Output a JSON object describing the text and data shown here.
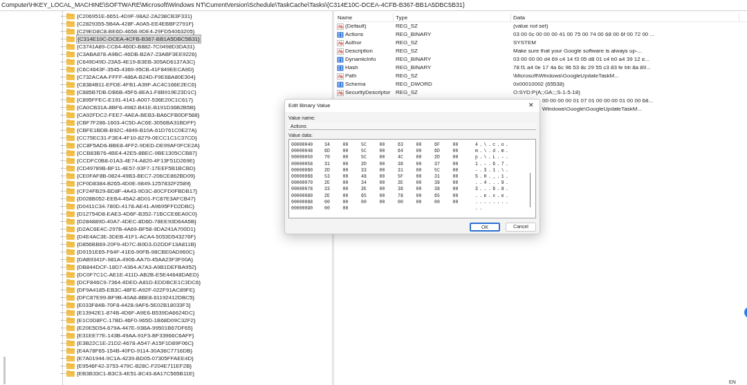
{
  "address_bar": "Computer\\HKEY_LOCAL_MACHINE\\SOFTWARE\\Microsoft\\Windows NT\\CurrentVersion\\Schedule\\TaskCache\\Tasks\\{C314E10C-DCEA-4CFB-B367-BB1A5DBC5B31}",
  "tree": {
    "items": [
      {
        "label": "{C206951E-6651-4D9F-98A2-2A238CB3F331}",
        "selected": false
      },
      {
        "label": "{C2829355-5B4A-428F-A0A5-EE4EBBF2791F}",
        "selected": false
      },
      {
        "label": "{C29ED8C8-BE6D-4658-9DE4-29FD54063205}",
        "selected": false
      },
      {
        "label": "{C314E10C-DCEA-4CFB-B367-BB1A5DBC5B31}",
        "selected": true
      },
      {
        "label": "{C3741A89-CC64-460D-B882-7C0498D3DA31}",
        "selected": false
      },
      {
        "label": "{C3ABA878-A9BC-46DB-B2A7-23ABF3EE9226}",
        "selected": false
      },
      {
        "label": "{C649D49D-23A5-4E19-B3EB-305AD6137A3C}",
        "selected": false
      },
      {
        "label": "{C6C4643F-3545-4369-95CB-41F849EECA9D}",
        "selected": false
      },
      {
        "label": "{C732ACAA-FFFF-486A-B24D-F9E68A80E304}",
        "selected": false
      },
      {
        "label": "{C8384B11-EFDE-4FB1-A39F-AC4C166E2EC6}",
        "selected": false
      },
      {
        "label": "{C885B7DB-DB6B-45F6-8EA1-F8B919E23D1C}",
        "selected": false
      },
      {
        "label": "{C895FFEC-E191-4141-A007-536E20C1C617}",
        "selected": false
      },
      {
        "label": "{CA0CB31A-8BF6-4982-B41E-B191D36B2B5B}",
        "selected": false
      },
      {
        "label": "{CA92FDC2-FEE7-4AEA-BEB3-BA6CFB0DF588}",
        "selected": false
      },
      {
        "label": "{CBF7F286-1603-4C5D-AC6E-3056BA31BDFF}",
        "selected": false
      },
      {
        "label": "{CBFE1BDB-B92C-4849-B10A-61D761C0E27A}",
        "selected": false
      },
      {
        "label": "{CC75EC31-F3E4-4F10-8279-0ECC1C1C37CD}",
        "selected": false
      },
      {
        "label": "{CC8F5AD6-BBE8-4FF2-9DED-DE99AF0FCE2A}",
        "selected": false
      },
      {
        "label": "{CCB83B76-4BE4-42E5-8BEC-9BE1305CCB87}",
        "selected": false
      },
      {
        "label": "{CCDFC0B8-01A3-4E74-A820-4F13F51D269E}",
        "selected": false
      },
      {
        "label": "{CD49789B-BF11-4E57-93F7-17EEF5B1BCBD}",
        "selected": false
      },
      {
        "label": "{CE0FAF8B-0824-49B3-BEC7-206CE862BD09}",
        "selected": false
      },
      {
        "label": "{CF0D8384-B265-4D0E-9849-1257832F2589}",
        "selected": false
      },
      {
        "label": "{CF24FB29-BD8F-4A43-9D3C-80CFD0FBDB17}",
        "selected": false
      },
      {
        "label": "{D028B052-EEB4-45A2-8D01-FC87E3AFCB47}",
        "selected": false
      },
      {
        "label": "{D0411C34-780D-4178-AE41-A9695FFD2DBC}",
        "selected": false
      },
      {
        "label": "{D12754D8-EAE3-4D6F-B352-71BCCE6EA0C0}",
        "selected": false
      },
      {
        "label": "{D284889D-40A7-4DEC-8D6D-78EE93D64A5B}",
        "selected": false
      },
      {
        "label": "{D2AC6E4C-297B-4A69-BF58-9DA241A700D1}",
        "selected": false
      },
      {
        "label": "{D4E4AC3E-3DEB-41F1-ACA4-5053D543276F}",
        "selected": false
      },
      {
        "label": "{D856BB69-20F9-4D7C-B0D3-D2DDF13A811B}",
        "selected": false
      },
      {
        "label": "{D9151E65-F64F-41E6-90FB-98CBE0AD960C}",
        "selected": false
      },
      {
        "label": "{DAB9341F-981A-4906-AA70-45AA23F3F00A}",
        "selected": false
      },
      {
        "label": "{DB844DCF-18D7-4364-A7A3-A9B1DEFBA952}",
        "selected": false
      },
      {
        "label": "{DC0F7C1C-AE1E-411D-AB2B-E5E44648DAED}",
        "selected": false
      },
      {
        "label": "{DCF846C9-7364-4DED-A81D-EDDBCE1C3DC6}",
        "selected": false
      },
      {
        "label": "{DF9A4185-EB3C-48FE-A92F-022F91AC89FE}",
        "selected": false
      },
      {
        "label": "{DFC87E99-BF9B-40A8-8BE8-61192412DBC5}",
        "selected": false
      },
      {
        "label": "{E033F84B-70F8-4428-9AF6-5E02B18033F3}",
        "selected": false
      },
      {
        "label": "{E13942E1-874B-4D6F-A9E6-B539DA6624DC}",
        "selected": false
      },
      {
        "label": "{E1C0D8FC-17BD-46F0-965D-1B68D09C32F2}",
        "selected": false
      },
      {
        "label": "{E20E5D54-679A-447E-93BA-99501B67DF65}",
        "selected": false
      },
      {
        "label": "{E31EE77E-143B-49AA-91F3-BF33966C6AFF}",
        "selected": false
      },
      {
        "label": "{E3B22C1E-21D2-4678-A547-A15F1D89F06C}",
        "selected": false
      },
      {
        "label": "{E4A78F65-154B-40FD-9114-30A36C7716DB}",
        "selected": false
      },
      {
        "label": "{E7A01944-9C1A-4239-BD05-07305FFAEE4D}",
        "selected": false
      },
      {
        "label": "{E9546F42-3753-479C-B28C-F204E711EF2B}",
        "selected": false
      },
      {
        "label": "{EB3B33C1-B3C3-4E51-8C43-8A17C565B11E}",
        "selected": false
      }
    ]
  },
  "values": {
    "columns": [
      "Name",
      "Type",
      "Data"
    ],
    "rows": [
      {
        "kind": "string",
        "name": "(Default)",
        "type": "REG_SZ",
        "data": "(value not set)"
      },
      {
        "kind": "binary",
        "name": "Actions",
        "type": "REG_BINARY",
        "data": "03 00 0c 00 00 00 41 00 75 00 74 00 68 00 6f 00 72 00 ..."
      },
      {
        "kind": "string",
        "name": "Author",
        "type": "REG_SZ",
        "data": "SYSTEM"
      },
      {
        "kind": "string",
        "name": "Description",
        "type": "REG_SZ",
        "data": "Make sure that your Google software is always up-..."
      },
      {
        "kind": "binary",
        "name": "DynamicInfo",
        "type": "REG_BINARY",
        "data": "03 00 00 00 d4 69 c4 14 f3 05 d8 01 c4 b0 a4 39 12 e..."
      },
      {
        "kind": "binary",
        "name": "Hash",
        "type": "REG_BINARY",
        "data": "78 f1 a4 0e 17 4a 6c 96 53 8c 29 55 c3 83 fe bb 8a 89..."
      },
      {
        "kind": "string",
        "name": "Path",
        "type": "REG_SZ",
        "data": "\\Microsoft\\Windows\\GoogleUpdateTaskM..."
      },
      {
        "kind": "binary",
        "name": "Schema",
        "type": "REG_DWORD",
        "data": "0x00010002 (65538)"
      },
      {
        "kind": "string",
        "name": "SecurityDescriptor",
        "type": "REG_SZ",
        "data": "O:SYD:P(A;;GA;;;S-1-5-18)"
      },
      {
        "kind": "partial",
        "data": "00 00 00 00 01 07 01 00 00 00 01 00 00 68..."
      },
      {
        "kind": "partial",
        "data": "Windows\\Google\\GoogleUpdateTaskM..."
      }
    ]
  },
  "dialog": {
    "title": "Edit Binary Value",
    "close": "✕",
    "value_name_label": "Value name:",
    "value_name": "Actions",
    "value_data_label": "Value data:",
    "hex_rows": [
      {
        "address": "00000040",
        "bytes": [
          "34",
          "00",
          "5C",
          "00",
          "63",
          "00",
          "6F",
          "00"
        ],
        "ascii": "4.\\.c.o."
      },
      {
        "address": "00000048",
        "bytes": [
          "6D",
          "00",
          "5C",
          "00",
          "64",
          "00",
          "6D",
          "00"
        ],
        "ascii": "m.\\.d.m."
      },
      {
        "address": "00000050",
        "bytes": [
          "70",
          "00",
          "5C",
          "00",
          "4C",
          "00",
          "2D",
          "00"
        ],
        "ascii": "p.\\.L.-."
      },
      {
        "address": "00000058",
        "bytes": [
          "31",
          "00",
          "2D",
          "00",
          "36",
          "00",
          "37",
          "00"
        ],
        "ascii": "1.-.6.7."
      },
      {
        "address": "00000060",
        "bytes": [
          "2D",
          "00",
          "33",
          "00",
          "31",
          "00",
          "5C",
          "00"
        ],
        "ascii": "-.3.1.\\."
      },
      {
        "address": "00000068",
        "bytes": [
          "53",
          "00",
          "48",
          "00",
          "5F",
          "00",
          "31",
          "00"
        ],
        "ascii": "S.H._.1."
      },
      {
        "address": "00000070",
        "bytes": [
          "2E",
          "00",
          "34",
          "00",
          "2E",
          "00",
          "39",
          "00"
        ],
        "ascii": "..4...9."
      },
      {
        "address": "00000078",
        "bytes": [
          "33",
          "00",
          "2E",
          "00",
          "36",
          "00",
          "38",
          "00"
        ],
        "ascii": "3...6.8."
      },
      {
        "address": "00000080",
        "bytes": [
          "2E",
          "00",
          "65",
          "00",
          "78",
          "00",
          "65",
          "00"
        ],
        "ascii": "..e.x.e."
      },
      {
        "address": "00000088",
        "bytes": [
          "00",
          "00",
          "00",
          "00",
          "00",
          "00",
          "00",
          "00"
        ],
        "ascii": "........"
      },
      {
        "address": "00000090",
        "bytes": [
          "00",
          "00"
        ],
        "ascii": ".."
      }
    ],
    "buttons": [
      {
        "label": "OK",
        "focused": true
      },
      {
        "label": "Cancel",
        "focused": false
      }
    ]
  },
  "status": {
    "language": "EN"
  }
}
